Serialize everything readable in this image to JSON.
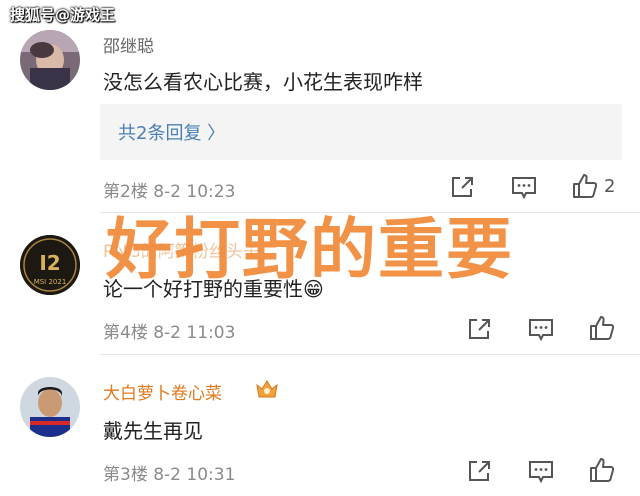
{
  "watermark": "搜狐号@游戏王",
  "overlay_title": "好打野的重要",
  "comments": [
    {
      "username": "邵继聪",
      "text": "没怎么看农心比赛，小花生表现咋样",
      "replies_label": "共2条回复 〉",
      "meta": "第2楼  8-2  10:23",
      "like_count": "2"
    },
    {
      "username": "RNG的阿策粉丝头子",
      "avatar_text_top": "I2",
      "avatar_text_bottom": "MSI 2021",
      "text": "论一个好打野的重要性😁",
      "meta": "第4楼  8-2  11:03"
    },
    {
      "username": "大白萝卜卷心菜",
      "text": "戴先生再见",
      "meta": "第3楼  8-2  10:31"
    }
  ],
  "colors": {
    "accent_orange": "#f08a3a",
    "link_blue": "#4a7fb5",
    "vip_name": "#e07a1f"
  },
  "icons": [
    "share-icon",
    "comment-icon",
    "like-icon",
    "crown-icon"
  ]
}
